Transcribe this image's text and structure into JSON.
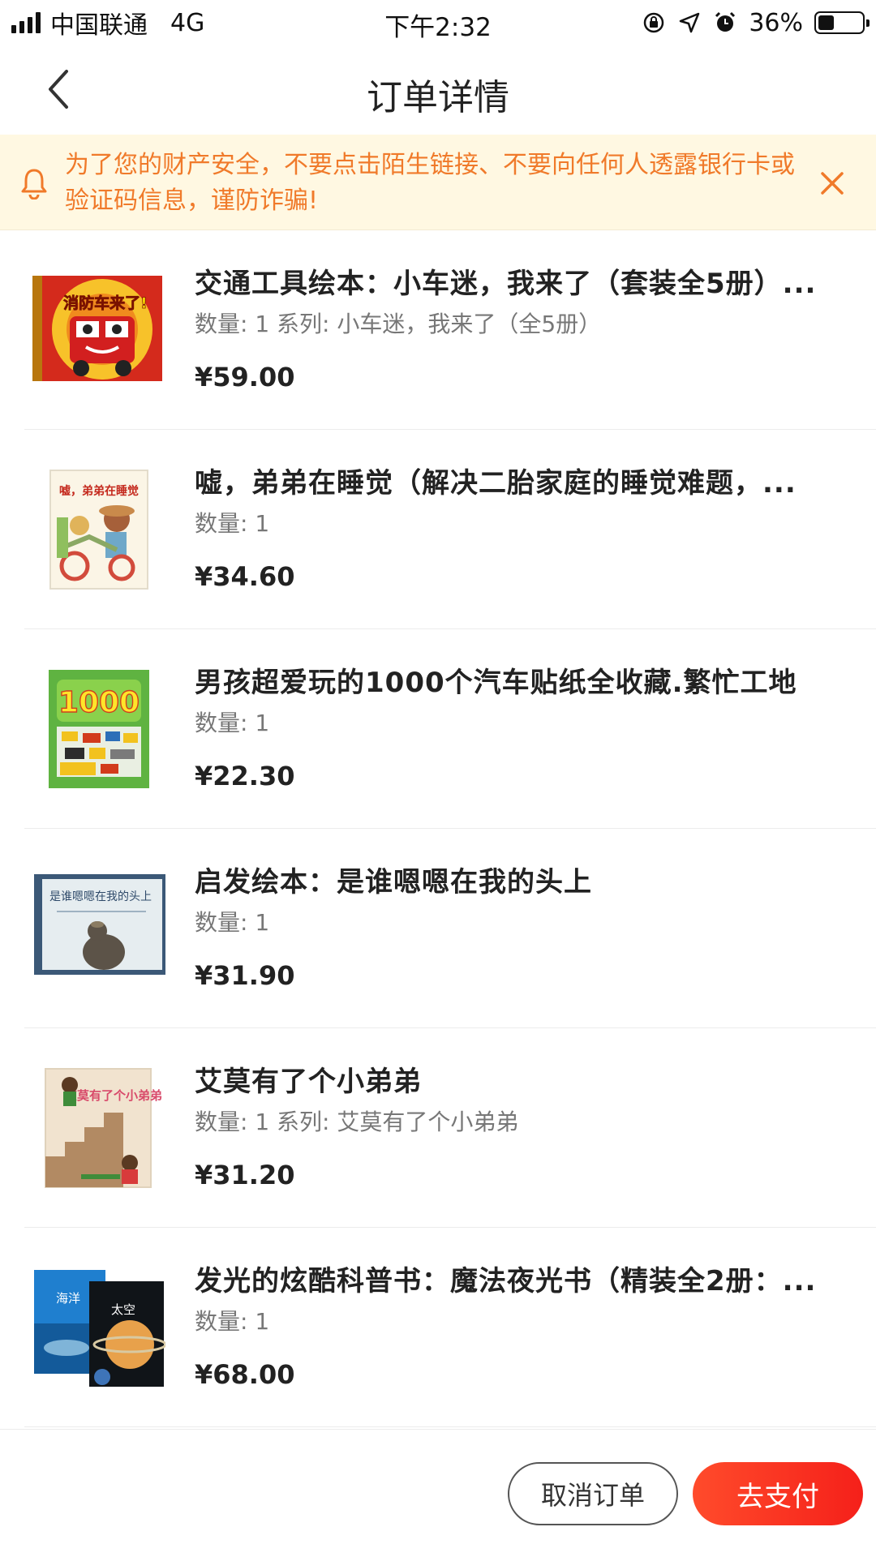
{
  "status_bar": {
    "carrier": "中国联通",
    "network": "4G",
    "time": "下午2:32",
    "battery_text": "36%",
    "battery_level": 0.36
  },
  "nav": {
    "title": "订单详情"
  },
  "notice": {
    "text": "为了您的财产安全，不要点击陌生链接、不要向任何人透露银行卡或验证码信息，谨防诈骗!"
  },
  "items": [
    {
      "title": "交通工具绘本：小车迷，我来了（套装全5册）...",
      "meta": "数量: 1 系列: 小车迷，我来了（全5册）",
      "price": "¥59.00",
      "cover_text": "消防车来了!"
    },
    {
      "title": "嘘，弟弟在睡觉（解决二胎家庭的睡觉难题，...",
      "meta": "数量: 1",
      "price": "¥34.60",
      "cover_text": "嘘，弟弟在睡觉"
    },
    {
      "title": "男孩超爱玩的1000个汽车贴纸全收藏.繁忙工地",
      "meta": "数量: 1",
      "price": "¥22.30",
      "cover_text": "1000"
    },
    {
      "title": "启发绘本：是谁嗯嗯在我的头上",
      "meta": "数量: 1",
      "price": "¥31.90",
      "cover_text": "是谁嗯嗯在我的头上"
    },
    {
      "title": "艾莫有了个小弟弟",
      "meta": "数量: 1 系列: 艾莫有了个小弟弟",
      "price": "¥31.20",
      "cover_text": "艾莫有了个小弟弟"
    },
    {
      "title": "发光的炫酷科普书：魔法夜光书（精装全2册：...",
      "meta": "数量: 1",
      "price": "¥68.00",
      "cover_text_1": "海洋",
      "cover_text_2": "太空"
    }
  ],
  "actions": {
    "cancel_label": "取消订单",
    "pay_label": "去支付"
  },
  "colors": {
    "accent": "#f5201a",
    "notice_text": "#f07a2a",
    "notice_bg": "#fff8e2"
  },
  "icons": [
    "signal-icon",
    "orientation-lock-icon",
    "location-icon",
    "alarm-icon",
    "battery-icon",
    "back-chevron-icon",
    "bell-icon",
    "close-icon"
  ]
}
